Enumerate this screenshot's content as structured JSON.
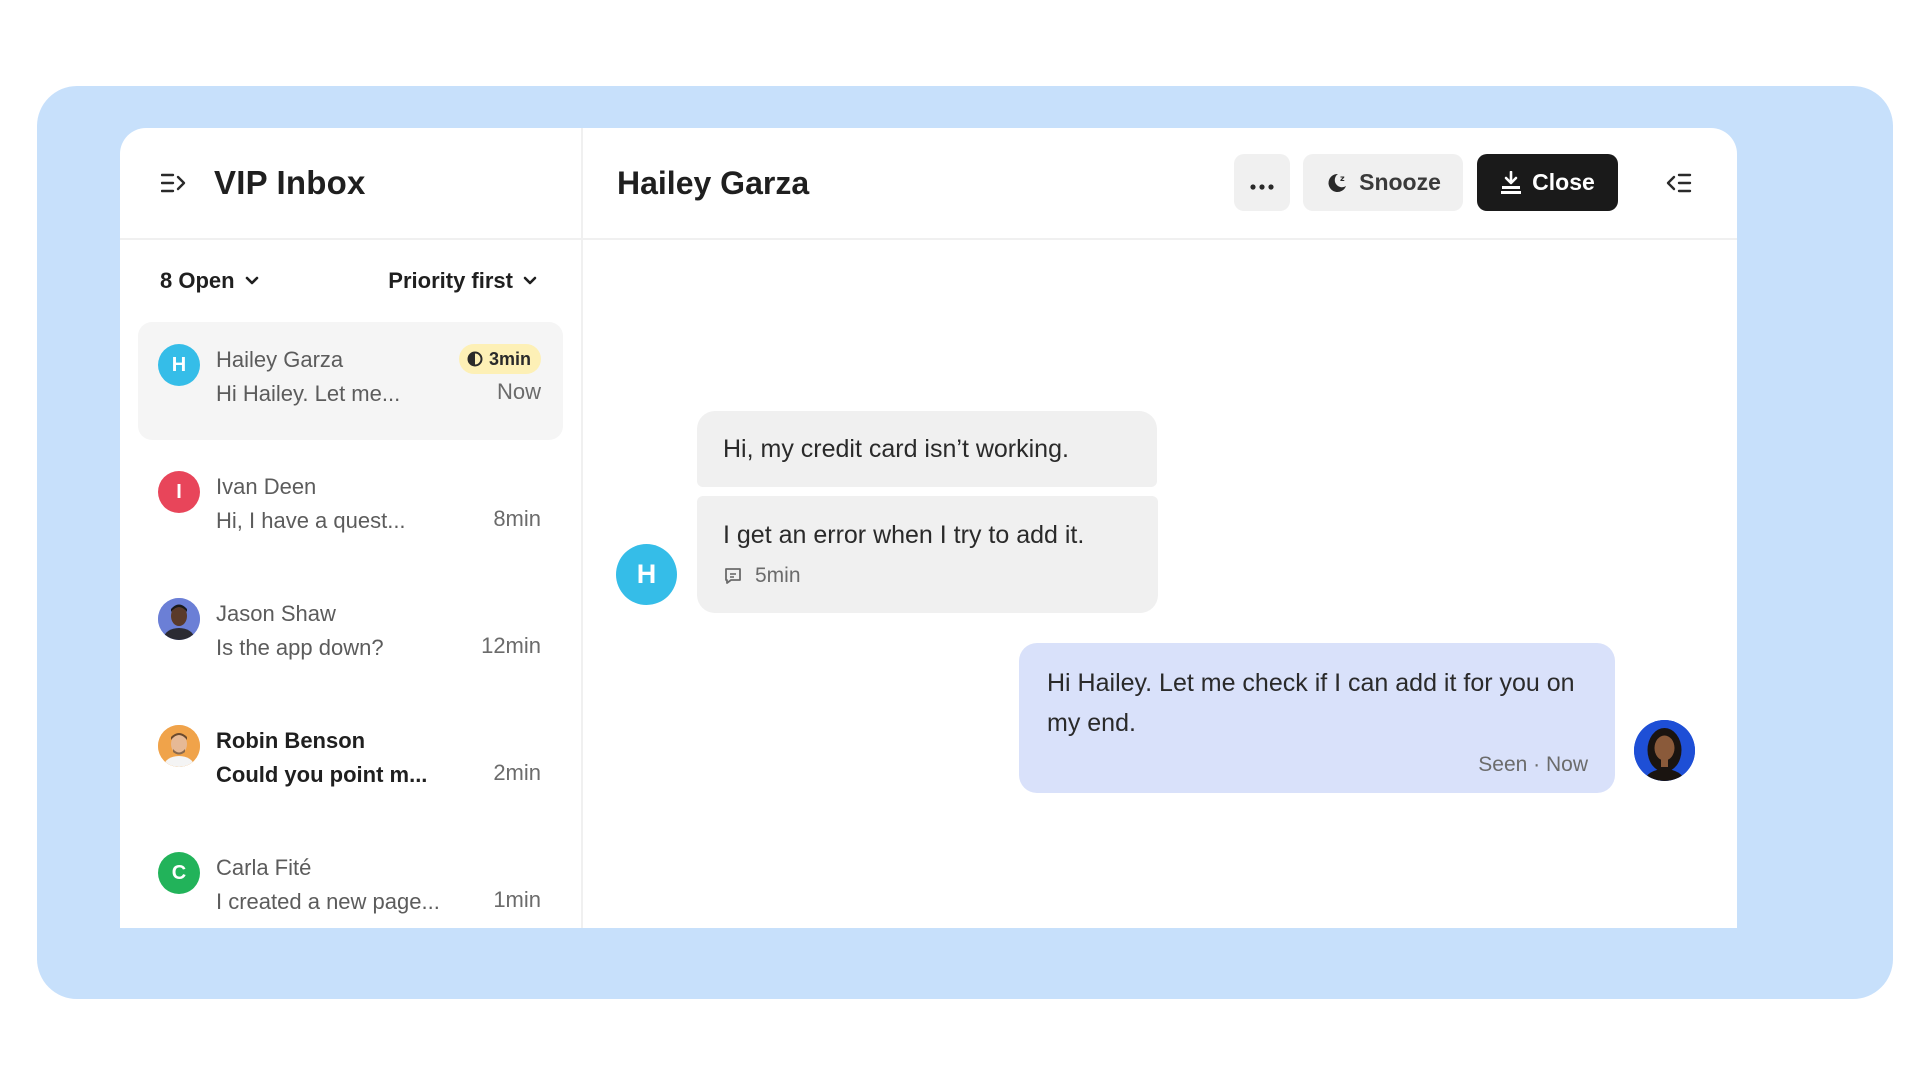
{
  "sidebar": {
    "title": "VIP Inbox",
    "filter_status": "8 Open",
    "filter_sort": "Priority first",
    "conversations": [
      {
        "initial": "H",
        "name": "Hailey Garza",
        "preview": "Hi Hailey. Let me...",
        "time": "Now",
        "badge": "3min",
        "color": "#35bde8"
      },
      {
        "initial": "I",
        "name": "Ivan Deen",
        "preview": "Hi, I have a quest...",
        "time": "8min",
        "color": "#e8455a"
      },
      {
        "initial": "",
        "name": "Jason Shaw",
        "preview": "Is the app down?",
        "time": "12min",
        "color": "#6b7fd6"
      },
      {
        "initial": "",
        "name": "Robin Benson",
        "preview": "Could you point m...",
        "time": "2min",
        "color": "#f0a34a"
      },
      {
        "initial": "C",
        "name": "Carla Fité",
        "preview": "I created a new page...",
        "time": "1min",
        "color": "#22b35a"
      }
    ]
  },
  "main": {
    "title": "Hailey Garza",
    "more_label": "•••",
    "snooze_label": "Snooze",
    "close_label": "Close",
    "customer_initial": "H",
    "messages": {
      "in_1": "Hi, my credit card isn’t working.",
      "in_2": "I get an error when I try to add it.",
      "in_2_meta": "5min",
      "out_1": "Hi Hailey. Let me check if I can add it for you on my end.",
      "out_1_status": "Seen · Now"
    }
  },
  "colors": {
    "backdrop": "#c7e0fb",
    "accent_dark": "#1a1a1a",
    "outgoing_bubble": "#d9e1fa",
    "incoming_bubble": "#f0f0f0",
    "badge": "#fdf0b6"
  }
}
